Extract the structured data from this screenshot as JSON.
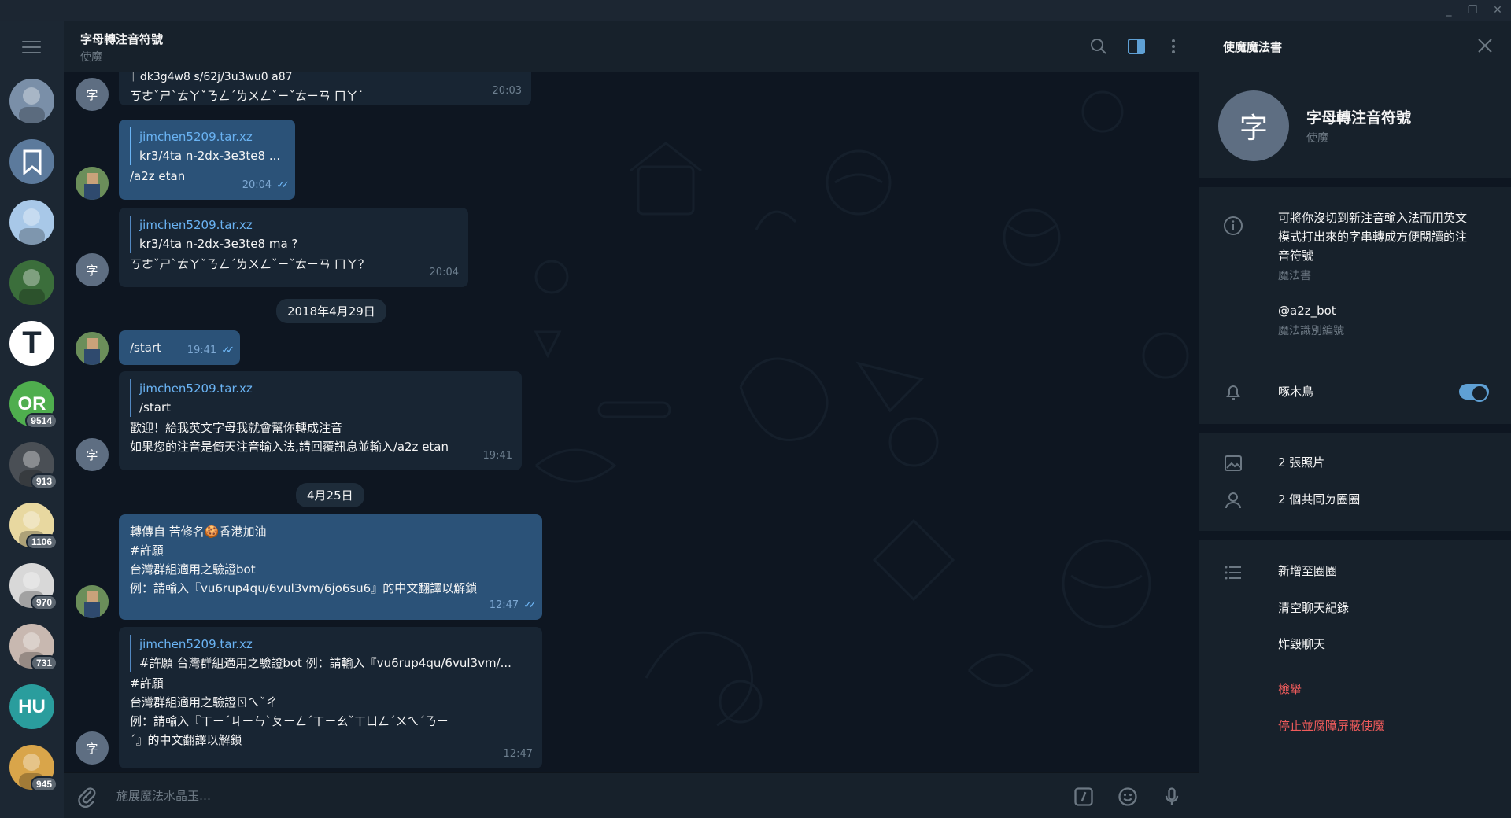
{
  "window": {
    "controls": {
      "minimize": "_",
      "restore": "❐",
      "close": "✕"
    }
  },
  "rail": {
    "chats": [
      {
        "kind": "photo",
        "color": "#7a8fa8",
        "badge": ""
      },
      {
        "kind": "saved",
        "color": "#5c7a9c",
        "badge": ""
      },
      {
        "kind": "photo",
        "color": "#a8c8e8",
        "badge": ""
      },
      {
        "kind": "photo",
        "color": "#3b6e3b",
        "badge": ""
      },
      {
        "kind": "letter",
        "text": "T",
        "color": "#ffffff",
        "badge": ""
      },
      {
        "kind": "letter",
        "text": "OR",
        "color": "#4fae4e",
        "badge": "9514"
      },
      {
        "kind": "photo",
        "color": "#4a4f55",
        "badge": "913"
      },
      {
        "kind": "photo",
        "color": "#e8d8a0",
        "badge": "1106"
      },
      {
        "kind": "photo",
        "color": "#d8d8d8",
        "badge": "970"
      },
      {
        "kind": "photo",
        "color": "#c8b8b0",
        "badge": "731"
      },
      {
        "kind": "letter",
        "text": "HU",
        "color": "#2a9d9d",
        "badge": ""
      },
      {
        "kind": "photo",
        "color": "#d9a54a",
        "badge": "945"
      }
    ]
  },
  "header": {
    "title": "字母轉注音符號",
    "subtitle": "使魔",
    "icons": [
      "search-icon",
      "sidebar-toggle-icon",
      "more-vertical-icon"
    ]
  },
  "messages": [
    {
      "id": "m1",
      "direction": "in",
      "partial_top": "ᛁ dk3g4w8 s/62j/3u3wu0 a87",
      "text": [
        "ㄎㄜˇㄕˋㄊㄚˇㄋㄥˊㄌㄨㄥˇㄧˇㄊㄧㄢ ㄇㄚ˙"
      ],
      "time": "20:03"
    },
    {
      "id": "m2",
      "direction": "out",
      "quote_name": "jimchen5209.tar.xz",
      "quote_text": "kr3/4ta n-2dx-3e3te8 ...",
      "text": [
        "/a2z etan"
      ],
      "time": "20:04"
    },
    {
      "id": "m3",
      "direction": "in",
      "quote_name": "jimchen5209.tar.xz",
      "quote_text": "kr3/4ta n-2dx-3e3te8 ma ?",
      "text": [
        "ㄎㄜˇㄕˋㄊㄚˇㄋㄥˊㄌㄨㄥˇㄧˇㄊㄧㄢ ㄇㄚ？"
      ],
      "time": "20:04"
    },
    {
      "id": "d1",
      "date": "2018年4月29日"
    },
    {
      "id": "m4",
      "direction": "out",
      "text": [
        "/start"
      ],
      "time": "19:41"
    },
    {
      "id": "m5",
      "direction": "in",
      "quote_name": "jimchen5209.tar.xz",
      "quote_text": "/start",
      "text": [
        "歡迎！給我英文字母我就會幫你轉成注音",
        "如果您的注音是倚天注音輸入法,請回覆訊息並輸入/a2z etan"
      ],
      "time": "19:41"
    },
    {
      "id": "d2",
      "date": "4月25日"
    },
    {
      "id": "m6",
      "direction": "out",
      "forward": "轉傳自 苦修名🍪香港加油",
      "text": [
        "#許願",
        "台灣群組適用之驗證bot",
        "例：請輸入『vu6rup4qu/6vul3vm/6jo6su6』的中文翻譯以解鎖"
      ],
      "time": "12:47"
    },
    {
      "id": "m7",
      "direction": "in",
      "quote_name": "jimchen5209.tar.xz",
      "quote_text": "#許願 台灣群組適用之驗證bot 例：請輸入『vu6rup4qu/6vul3vm/...",
      "text": [
        "#許願",
        "台灣群組適用之驗證ㄖㄟˇㄔ",
        "例：請輸入『ㄒㄧˊㄐㄧㄣˋㄆㄧㄥˊㄒㄧㄠˇㄒㄩㄥˊㄨㄟˊㄋㄧ",
        "ˊ』的中文翻譯以解鎖"
      ],
      "time": "12:47"
    }
  ],
  "composer": {
    "placeholder": "施展魔法水晶玉…",
    "icons": [
      "attach-icon",
      "bot-command-icon",
      "emoji-icon",
      "microphone-icon"
    ]
  },
  "panel": {
    "title": "使魔魔法書",
    "avatar_letter": "字",
    "name": "字母轉注音符號",
    "status": "使魔",
    "about": [
      "可將你沒切到新注音輸入法而用英文",
      "模式打出來的字串轉成方便閱讀的注",
      "音符號"
    ],
    "about_caption": "魔法書",
    "username": "@a2z_bot",
    "username_caption": "魔法識別編號",
    "notifications_label": "啄木鳥",
    "notifications_on": true,
    "media_photos": "2 張照片",
    "common_groups": "2 個共同ㄉ圈圈",
    "actions": {
      "add_to_group": "新增至圈圈",
      "clear_history": "清空聊天紀錄",
      "delete_chat": "炸毀聊天",
      "report": "檢舉",
      "block": "停止並腐障屏蔽使魔"
    },
    "colors": {
      "danger": "#ef5b5b",
      "accent": "#5fa0d4"
    }
  }
}
